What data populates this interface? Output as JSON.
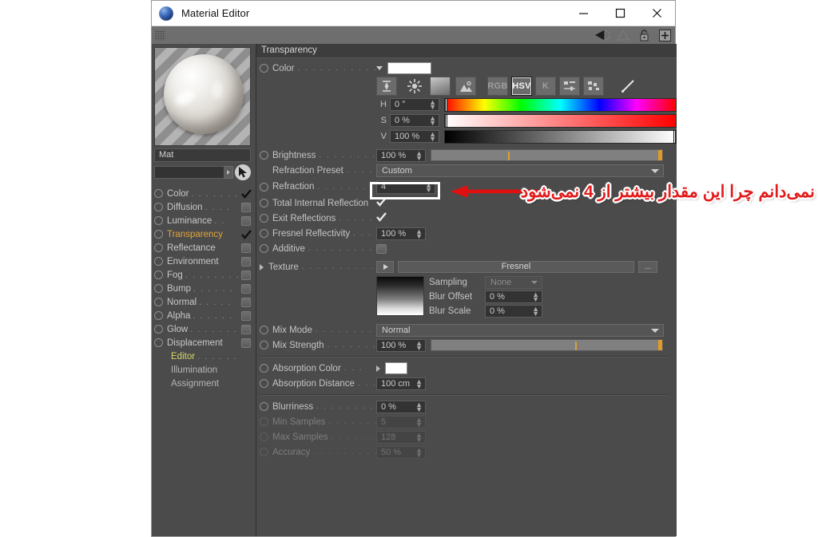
{
  "window": {
    "title": "Material Editor",
    "icon": "material-sphere-icon",
    "minimize": "—",
    "maximize": "□",
    "close": "✕"
  },
  "toolbar": {
    "icons": [
      "arrow-left-icon",
      "triangle-icon",
      "lock-icon",
      "plus-icon"
    ]
  },
  "sidebar": {
    "material_name": "Mat",
    "search_value": "",
    "channels": [
      {
        "label": "Color",
        "dots": ". . . . . . .",
        "state": "checked",
        "active": false
      },
      {
        "label": "Diffusion",
        "dots": ". . . .",
        "state": "box",
        "active": false
      },
      {
        "label": "Luminance",
        "dots": ". .",
        "state": "box",
        "active": false
      },
      {
        "label": "Transparency",
        "dots": "",
        "state": "checked",
        "active": true
      },
      {
        "label": "Reflectance",
        "dots": "",
        "state": "box",
        "active": false
      },
      {
        "label": "Environment",
        "dots": "",
        "state": "box",
        "active": false
      },
      {
        "label": "Fog",
        "dots": ". . . . . . . .",
        "state": "box",
        "active": false
      },
      {
        "label": "Bump",
        "dots": ". . . . . .",
        "state": "box",
        "active": false
      },
      {
        "label": "Normal",
        "dots": ". . . . .",
        "state": "box",
        "active": false
      },
      {
        "label": "Alpha",
        "dots": ". . . . . .",
        "state": "box",
        "active": false
      },
      {
        "label": "Glow",
        "dots": ". . . . . . .",
        "state": "box",
        "active": false
      },
      {
        "label": "Displacement",
        "dots": "",
        "state": "box",
        "active": false
      }
    ],
    "plain_items": [
      {
        "label": "Editor",
        "dots": ". . . . . .",
        "highlight": true
      },
      {
        "label": "Illumination",
        "dots": "",
        "highlight": false
      },
      {
        "label": "Assignment",
        "dots": "",
        "highlight": false
      }
    ]
  },
  "panel": {
    "section_title": "Transparency",
    "color": {
      "label": "Color",
      "dots": ". . . . . . . . . . . .",
      "swatch_hex": "#ffffff",
      "mode_buttons": [
        {
          "name": "range-icon",
          "label": "",
          "selected": false
        },
        {
          "name": "color-wheel-icon",
          "label": "",
          "selected": false
        },
        {
          "name": "gradient-icon",
          "label": "",
          "selected": false
        },
        {
          "name": "picture-icon",
          "label": "",
          "selected": false
        },
        {
          "name": "rgb-button",
          "label": "RGB",
          "selected": false
        },
        {
          "name": "hsv-button",
          "label": "HSV",
          "selected": true
        },
        {
          "name": "kelvin-button",
          "label": "K",
          "selected": false
        },
        {
          "name": "mixer-icon",
          "label": "",
          "selected": false
        },
        {
          "name": "swatches-icon",
          "label": "",
          "selected": false
        },
        {
          "name": "eyedropper-icon",
          "label": "",
          "selected": false
        }
      ],
      "hsv": [
        {
          "channel": "H",
          "value": "0 °",
          "pos_pct": 0
        },
        {
          "channel": "S",
          "value": "0 %",
          "pos_pct": 0
        },
        {
          "channel": "V",
          "value": "100 %",
          "pos_pct": 100
        }
      ]
    },
    "brightness": {
      "label": "Brightness",
      "dots": ". . . . . . . . . .",
      "value": "100 %",
      "slider_pct": 100
    },
    "refraction_preset": {
      "label": "Refraction Preset",
      "dots": ". . . . . .",
      "value": "Custom"
    },
    "refraction": {
      "label": "Refraction",
      "dots": ". . . . . . . . . .",
      "value": "4"
    },
    "total_internal_reflection": {
      "label": "Total Internal Reflection",
      "dots": "",
      "checked": true
    },
    "exit_reflections": {
      "label": "Exit Reflections",
      "dots": ". . . . . . .",
      "checked": true
    },
    "fresnel_reflectivity": {
      "label": "Fresnel Reflectivity",
      "dots": ". . . .",
      "value": "100 %"
    },
    "additive": {
      "label": "Additive",
      "dots": ". . . . . . . . . . . .",
      "checked": false
    },
    "texture": {
      "label": "Texture",
      "dots": ". . . . . . . . . . . .",
      "value": "Fresnel",
      "more_button": "...",
      "sampling": {
        "label": "Sampling",
        "value": "None"
      },
      "blur_offset": {
        "label": "Blur Offset",
        "value": "0 %"
      },
      "blur_scale": {
        "label": "Blur Scale",
        "value": "0 %"
      }
    },
    "mix_mode": {
      "label": "Mix Mode",
      "dots": ". . . . . . . . . . .",
      "value": "Normal"
    },
    "mix_strength": {
      "label": "Mix Strength",
      "dots": ". . . . . . . . .",
      "value": "100 %",
      "slider_pct": 100
    },
    "absorption_color": {
      "label": "Absorption Color",
      "dots": ". . .",
      "swatch_hex": "#ffffff"
    },
    "absorption_distance": {
      "label": "Absorption Distance",
      "dots": ". . .",
      "value": "100 cm"
    },
    "blurriness": {
      "label": "Blurriness",
      "dots": ". . . . . . . . . . .",
      "value": "0 %"
    },
    "min_samples": {
      "label": "Min Samples",
      "dots": ". . . . . . . . .",
      "value": "5"
    },
    "max_samples": {
      "label": "Max Samples",
      "dots": ". . . . . . . . .",
      "value": "128"
    },
    "accuracy": {
      "label": "Accuracy",
      "dots": ". . . . . . . . . . . .",
      "value": "50 %"
    }
  },
  "annotation": {
    "text": "نمی‌دانم چرا این مقدار بیشتر از 4 نمی‌شود",
    "arrow": "arrow-left-annotation",
    "color_hex": "#e21b1b",
    "highlight_target": "refraction-field"
  }
}
